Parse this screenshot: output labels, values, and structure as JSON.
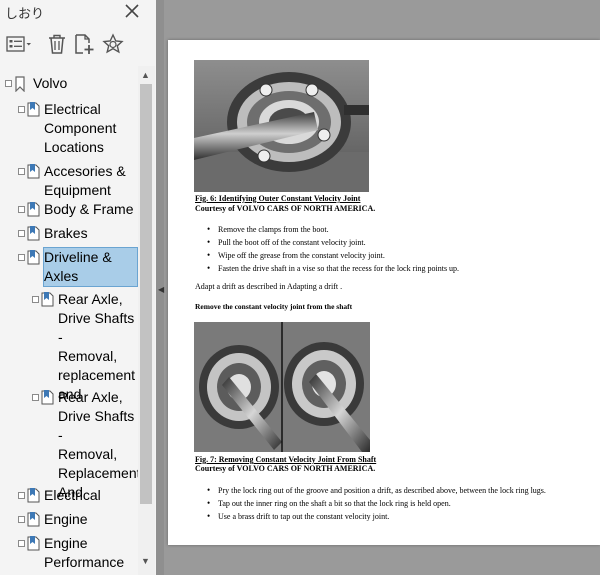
{
  "panel": {
    "title": "しおり",
    "icons": {
      "close": "close-icon",
      "options": "options-menu-icon",
      "delete": "trash-icon",
      "new": "add-bookmark-icon",
      "find": "find-bookmark-icon"
    }
  },
  "bookmarks": {
    "root": {
      "label": "Volvo"
    },
    "items": [
      {
        "lines": [
          "Electrical",
          "Component",
          "Locations"
        ]
      },
      {
        "lines": [
          "Accesories &",
          "Equipment"
        ]
      },
      {
        "lines": [
          "Body & Frame"
        ]
      },
      {
        "lines": [
          "Brakes"
        ]
      },
      {
        "lines": [
          "Driveline &",
          "Axles"
        ],
        "selected": true
      },
      {
        "lines": [
          "Rear Axle,",
          "Drive Shafts -",
          "Removal,",
          "replacement",
          "and"
        ]
      },
      {
        "lines": [
          "Rear Axle,",
          "Drive Shafts -",
          "Removal,",
          "Replacement",
          "And"
        ]
      },
      {
        "lines": [
          "Electrical"
        ]
      },
      {
        "lines": [
          "Engine"
        ]
      },
      {
        "lines": [
          "Engine",
          "Performance"
        ]
      }
    ]
  },
  "document": {
    "fig6": {
      "caption": "Fig. 6: Identifying Outer Constant Velocity Joint",
      "credit": "Courtesy of VOLVO CARS OF NORTH AMERICA."
    },
    "list1": [
      "Remove the clamps from the boot.",
      "Pull the boot off of the constant velocity joint.",
      "Wipe off the grease from the constant velocity joint.",
      "Fasten the drive shaft in a vise so that the recess for the lock ring points up."
    ],
    "para1": "Adapt a drift as described in Adapting a drift .",
    "para2": "Remove the constant velocity joint from the shaft",
    "fig7": {
      "caption": "Fig. 7: Removing Constant Velocity Joint From Shaft",
      "credit": "Courtesy of VOLVO CARS OF NORTH AMERICA."
    },
    "list2": [
      "Pry the lock ring out of the groove and position a drift, as described above, between the lock ring lugs.",
      "Tap out the inner ring on the shaft a bit so that the lock ring is held open.",
      "Use a brass drift to tap out the constant velocity joint."
    ]
  }
}
